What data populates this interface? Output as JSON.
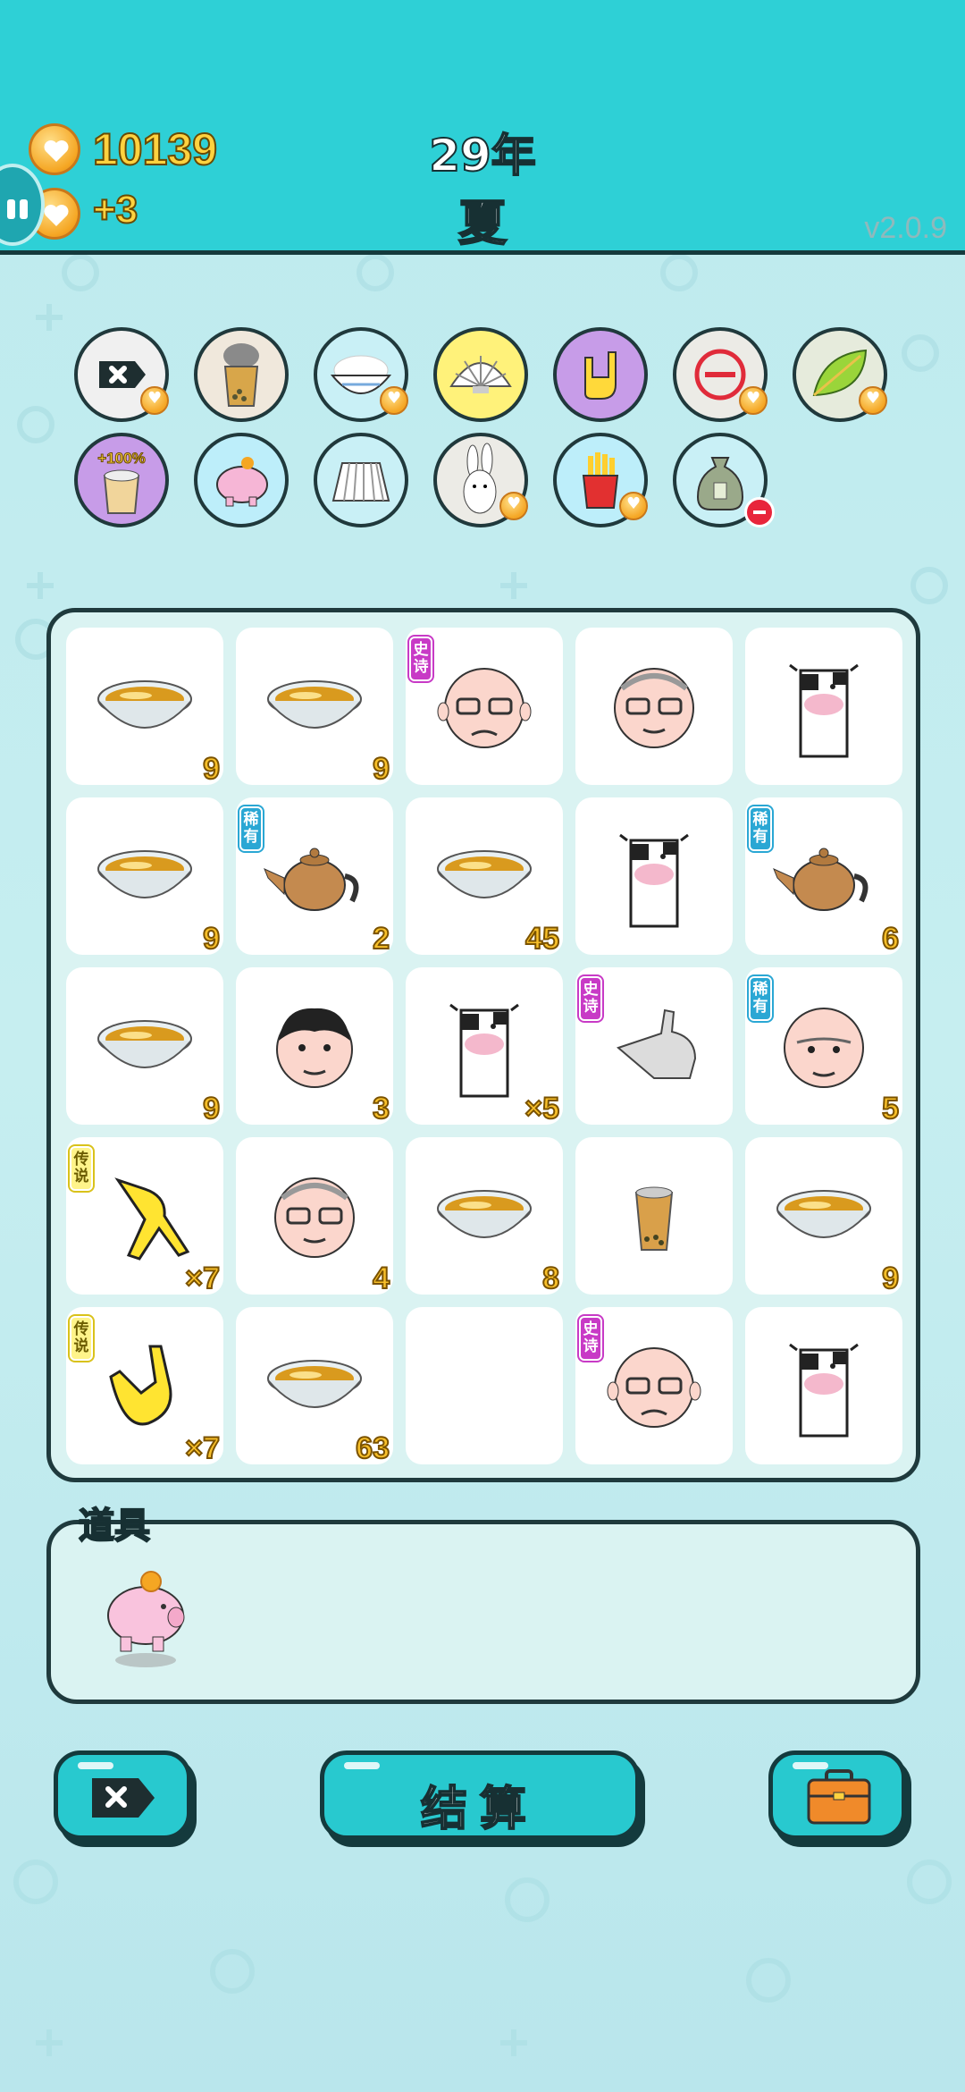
{
  "header": {
    "money": "10139",
    "income": "+3",
    "year": "29年",
    "season": "夏",
    "version": "v2.0.9"
  },
  "symbols_row1": [
    "removal-token-icon",
    "milk-tea-cup-icon",
    "rice-bowl-icon",
    "shell-icon",
    "rock-hand-icon",
    "no-entry-icon",
    "leaf-icon"
  ],
  "symbols_row2": [
    "milk-tea-bonus-icon",
    "piggy-bank-icon",
    "pleated-skirt-icon",
    "bunny-icon",
    "fries-icon",
    "money-bag-icon"
  ],
  "symbol_bonus_text": "+100%",
  "board": [
    [
      {
        "icon": "bowl",
        "count": "9"
      },
      {
        "icon": "bowl",
        "count": "9"
      },
      {
        "icon": "old-man",
        "tag": "史诗",
        "rarity": "epic"
      },
      {
        "icon": "grandpa",
        "count": ""
      },
      {
        "icon": "cow",
        "count": ""
      }
    ],
    [
      {
        "icon": "bowl",
        "count": "9"
      },
      {
        "icon": "teapot",
        "tag": "稀有",
        "rarity": "rare",
        "count": "2"
      },
      {
        "icon": "bowl",
        "count": "45"
      },
      {
        "icon": "cow",
        "count": ""
      },
      {
        "icon": "teapot",
        "tag": "稀有",
        "rarity": "rare",
        "count": "6"
      }
    ],
    [
      {
        "icon": "bowl",
        "count": "9"
      },
      {
        "icon": "man",
        "count": "3"
      },
      {
        "icon": "cow",
        "count": "×5"
      },
      {
        "icon": "pointing-hand",
        "tag": "史诗",
        "rarity": "epic",
        "count": ""
      },
      {
        "icon": "bald-man",
        "tag": "稀有",
        "rarity": "rare",
        "count": "5"
      }
    ],
    [
      {
        "icon": "yellow-point-hand",
        "tag": "传说",
        "rarity": "legend",
        "count": "×7"
      },
      {
        "icon": "grandpa",
        "count": "4"
      },
      {
        "icon": "bowl",
        "count": "8"
      },
      {
        "icon": "milk-tea",
        "count": ""
      },
      {
        "icon": "bowl",
        "count": "9"
      }
    ],
    [
      {
        "icon": "yellow-rock-hand",
        "tag": "传说",
        "rarity": "legend",
        "count": "×7"
      },
      {
        "icon": "bowl",
        "count": "63"
      },
      {
        "icon": "empty",
        "count": ""
      },
      {
        "icon": "old-man",
        "tag": "史诗",
        "rarity": "epic",
        "count": ""
      },
      {
        "icon": "cow",
        "count": ""
      }
    ]
  ],
  "items": {
    "title": "道具",
    "list": [
      "piggy-bank-icon"
    ]
  },
  "buttons": {
    "settle": "结算"
  },
  "colors": {
    "header": "#2ed0d6",
    "gold": "#f8c02a",
    "button": "#28c9cf"
  }
}
